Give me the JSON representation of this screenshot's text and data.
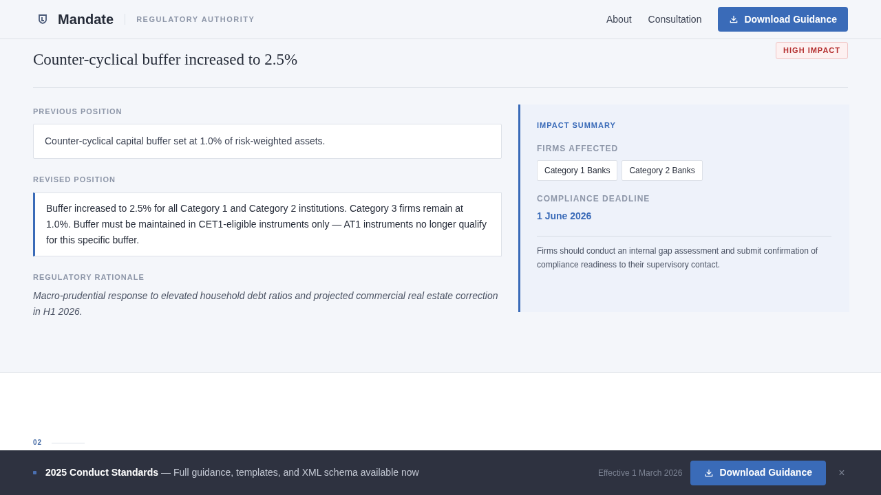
{
  "header": {
    "brand": "Mandate",
    "tagline": "REGULATORY AUTHORITY",
    "nav": [
      "About",
      "Consultation"
    ],
    "cta": "Download Guidance"
  },
  "change": {
    "title": "Counter-cyclical buffer increased to 2.5%",
    "badge": "HIGH IMPACT",
    "previous": {
      "label": "PREVIOUS POSITION",
      "text": "Counter-cyclical capital buffer set at 1.0% of risk-weighted assets."
    },
    "revised": {
      "label": "REVISED POSITION",
      "text": "Buffer increased to 2.5% for all Category 1 and Category 2 institutions. Category 3 firms remain at 1.0%. Buffer must be maintained in CET1-eligible instruments only — AT1 instruments no longer qualify for this specific buffer."
    },
    "rationale": {
      "label": "REGULATORY RATIONALE",
      "text": "Macro-prudential response to elevated household debt ratios and projected commercial real estate correction in H1 2026."
    },
    "summary": {
      "title": "IMPACT SUMMARY",
      "firms_label": "FIRMS AFFECTED",
      "firms": [
        "Category 1 Banks",
        "Category 2 Banks"
      ],
      "deadline_label": "COMPLIANCE DEADLINE",
      "deadline": "1 June 2026",
      "note": "Firms should conduct an internal gap assessment and submit confirmation of compliance readiness to their supervisory contact."
    }
  },
  "next_section": {
    "number": "02"
  },
  "banner": {
    "message": "**2025 Conduct Standards** — Full guidance, templates, and XML schema available now",
    "effective": "Effective 1 March 2026",
    "cta": "Download Guidance",
    "close": "×"
  }
}
